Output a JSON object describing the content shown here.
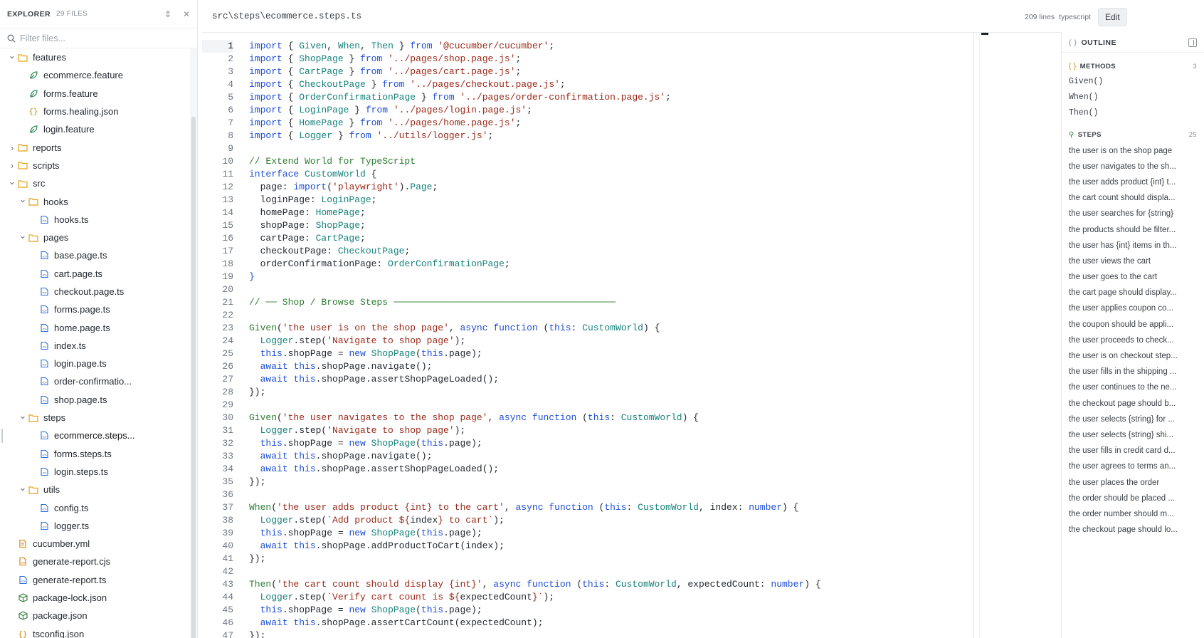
{
  "explorer": {
    "title": "EXPLORER",
    "count": "29 FILES",
    "filter_placeholder": "Filter files...",
    "tree": [
      {
        "label": "features",
        "kind": "folder",
        "depth": 0,
        "open": true
      },
      {
        "label": "ecommerce.feature",
        "kind": "feature",
        "depth": 1
      },
      {
        "label": "forms.feature",
        "kind": "feature",
        "depth": 1
      },
      {
        "label": "forms.healing.json",
        "kind": "json",
        "depth": 1
      },
      {
        "label": "login.feature",
        "kind": "feature",
        "depth": 1
      },
      {
        "label": "reports",
        "kind": "folder",
        "depth": 0,
        "open": false
      },
      {
        "label": "scripts",
        "kind": "folder",
        "depth": 0,
        "open": false
      },
      {
        "label": "src",
        "kind": "folder",
        "depth": 0,
        "open": true
      },
      {
        "label": "hooks",
        "kind": "folder",
        "depth": 1,
        "open": true
      },
      {
        "label": "hooks.ts",
        "kind": "ts",
        "depth": 2
      },
      {
        "label": "pages",
        "kind": "folder",
        "depth": 1,
        "open": true
      },
      {
        "label": "base.page.ts",
        "kind": "ts",
        "depth": 2
      },
      {
        "label": "cart.page.ts",
        "kind": "ts",
        "depth": 2
      },
      {
        "label": "checkout.page.ts",
        "kind": "ts",
        "depth": 2
      },
      {
        "label": "forms.page.ts",
        "kind": "ts",
        "depth": 2
      },
      {
        "label": "home.page.ts",
        "kind": "ts",
        "depth": 2
      },
      {
        "label": "index.ts",
        "kind": "ts",
        "depth": 2
      },
      {
        "label": "login.page.ts",
        "kind": "ts",
        "depth": 2
      },
      {
        "label": "order-confirmatio...",
        "kind": "ts",
        "depth": 2
      },
      {
        "label": "shop.page.ts",
        "kind": "ts",
        "depth": 2
      },
      {
        "label": "steps",
        "kind": "folder",
        "depth": 1,
        "open": true
      },
      {
        "label": "ecommerce.steps...",
        "kind": "ts",
        "depth": 2,
        "active": true
      },
      {
        "label": "forms.steps.ts",
        "kind": "ts",
        "depth": 2
      },
      {
        "label": "login.steps.ts",
        "kind": "ts",
        "depth": 2
      },
      {
        "label": "utils",
        "kind": "folder",
        "depth": 1,
        "open": true
      },
      {
        "label": "config.ts",
        "kind": "ts",
        "depth": 2
      },
      {
        "label": "logger.ts",
        "kind": "ts",
        "depth": 2
      },
      {
        "label": "cucumber.yml",
        "kind": "yml",
        "depth": 0
      },
      {
        "label": "generate-report.cjs",
        "kind": "js",
        "depth": 0
      },
      {
        "label": "generate-report.ts",
        "kind": "ts",
        "depth": 0
      },
      {
        "label": "package-lock.json",
        "kind": "pkg",
        "depth": 0
      },
      {
        "label": "package.json",
        "kind": "pkg",
        "depth": 0
      },
      {
        "label": "tsconfig.json",
        "kind": "json",
        "depth": 0
      }
    ]
  },
  "editor": {
    "path": "src\\steps\\ecommerce.steps.ts",
    "lines_count": "209 lines",
    "language": "typescript",
    "edit_label": "Edit",
    "current_line": 1,
    "code": [
      [
        [
          "kw",
          "import"
        ],
        [
          "",
          "{ "
        ],
        [
          "ty",
          "Given"
        ],
        [
          "",
          ", "
        ],
        [
          "ty",
          "When"
        ],
        [
          "",
          ", "
        ],
        [
          "ty",
          "Then"
        ],
        [
          "",
          " } "
        ],
        [
          "kw",
          "from"
        ],
        [
          "",
          " "
        ],
        [
          "st",
          "'@cucumber/cucumber'"
        ],
        [
          "",
          ";"
        ]
      ],
      [
        [
          "kw",
          "import"
        ],
        [
          "",
          "{ "
        ],
        [
          "ty",
          "ShopPage"
        ],
        [
          "",
          " } "
        ],
        [
          "kw",
          "from"
        ],
        [
          "",
          " "
        ],
        [
          "st",
          "'../pages/shop.page.js'"
        ],
        [
          "",
          ";"
        ]
      ],
      [
        [
          "kw",
          "import"
        ],
        [
          "",
          "{ "
        ],
        [
          "ty",
          "CartPage"
        ],
        [
          "",
          " } "
        ],
        [
          "kw",
          "from"
        ],
        [
          "",
          " "
        ],
        [
          "st",
          "'../pages/cart.page.js'"
        ],
        [
          "",
          ";"
        ]
      ],
      [
        [
          "kw",
          "import"
        ],
        [
          "",
          "{ "
        ],
        [
          "ty",
          "CheckoutPage"
        ],
        [
          "",
          " } "
        ],
        [
          "kw",
          "from"
        ],
        [
          "",
          " "
        ],
        [
          "st",
          "'../pages/checkout.page.js'"
        ],
        [
          "",
          ";"
        ]
      ],
      [
        [
          "kw",
          "import"
        ],
        [
          "",
          "{ "
        ],
        [
          "ty",
          "OrderConfirmationPage"
        ],
        [
          "",
          " } "
        ],
        [
          "kw",
          "from"
        ],
        [
          "",
          " "
        ],
        [
          "st",
          "'../pages/order-confirmation.page.js'"
        ],
        [
          "",
          ";"
        ]
      ],
      [
        [
          "kw",
          "import"
        ],
        [
          "",
          "{ "
        ],
        [
          "ty",
          "LoginPage"
        ],
        [
          "",
          " } "
        ],
        [
          "kw",
          "from"
        ],
        [
          "",
          " "
        ],
        [
          "st",
          "'../pages/login.page.js'"
        ],
        [
          "",
          ";"
        ]
      ],
      [
        [
          "kw",
          "import"
        ],
        [
          "",
          "{ "
        ],
        [
          "ty",
          "HomePage"
        ],
        [
          "",
          " } "
        ],
        [
          "kw",
          "from"
        ],
        [
          "",
          " "
        ],
        [
          "st",
          "'../pages/home.page.js'"
        ],
        [
          "",
          ";"
        ]
      ],
      [
        [
          "kw",
          "import"
        ],
        [
          "",
          "{ "
        ],
        [
          "ty",
          "Logger"
        ],
        [
          "",
          " } "
        ],
        [
          "kw",
          "from"
        ],
        [
          "",
          " "
        ],
        [
          "st",
          "'../utils/logger.js'"
        ],
        [
          "",
          ";"
        ]
      ],
      [],
      [
        [
          "cm",
          "// Extend World for TypeScript"
        ]
      ],
      [
        [
          "kw",
          "interface"
        ],
        [
          "",
          " "
        ],
        [
          "ty",
          "CustomWorld"
        ],
        [
          "",
          " {"
        ]
      ],
      [
        [
          "",
          "  page: "
        ],
        [
          "kw",
          "import"
        ],
        [
          "",
          "("
        ],
        [
          "st",
          "'playwright'"
        ],
        [
          "",
          ")."
        ],
        [
          "ty",
          "Page"
        ],
        [
          "",
          ";"
        ]
      ],
      [
        [
          "",
          "  loginPage: "
        ],
        [
          "ty",
          "LoginPage"
        ],
        [
          "",
          ";"
        ]
      ],
      [
        [
          "",
          "  homePage: "
        ],
        [
          "ty",
          "HomePage"
        ],
        [
          "",
          ";"
        ]
      ],
      [
        [
          "",
          "  shopPage: "
        ],
        [
          "ty",
          "ShopPage"
        ],
        [
          "",
          ";"
        ]
      ],
      [
        [
          "",
          "  cartPage: "
        ],
        [
          "ty",
          "CartPage"
        ],
        [
          "",
          ";"
        ]
      ],
      [
        [
          "",
          "  checkoutPage: "
        ],
        [
          "ty",
          "CheckoutPage"
        ],
        [
          "",
          ";"
        ]
      ],
      [
        [
          "",
          "  orderConfirmationPage: "
        ],
        [
          "ty",
          "OrderConfirmationPage"
        ],
        [
          "",
          ";"
        ]
      ],
      [
        [
          "kw",
          "}"
        ]
      ],
      [],
      [
        [
          "cm",
          "// ── Shop / Browse Steps ────────────────────────────────────────"
        ]
      ],
      [],
      [
        [
          "fn",
          "Given"
        ],
        [
          "",
          "("
        ],
        [
          "st",
          "'the user is on the shop page'"
        ],
        [
          "",
          ", "
        ],
        [
          "kw",
          "async function"
        ],
        [
          "",
          " ("
        ],
        [
          "kw",
          "this"
        ],
        [
          "",
          ": "
        ],
        [
          "ty",
          "CustomWorld"
        ],
        [
          "",
          ") {"
        ]
      ],
      [
        [
          "",
          "  "
        ],
        [
          "ty",
          "Logger"
        ],
        [
          "",
          ".step("
        ],
        [
          "st",
          "'Navigate to shop page'"
        ],
        [
          "",
          ");"
        ]
      ],
      [
        [
          "",
          "  "
        ],
        [
          "kw",
          "this"
        ],
        [
          "",
          ".shopPage = "
        ],
        [
          "kw",
          "new"
        ],
        [
          "",
          " "
        ],
        [
          "ty",
          "ShopPage"
        ],
        [
          "",
          "("
        ],
        [
          "kw",
          "this"
        ],
        [
          "",
          ".page);"
        ]
      ],
      [
        [
          "",
          "  "
        ],
        [
          "kw",
          "await"
        ],
        [
          "",
          " "
        ],
        [
          "kw",
          "this"
        ],
        [
          "",
          ".shopPage.navigate();"
        ]
      ],
      [
        [
          "",
          "  "
        ],
        [
          "kw",
          "await"
        ],
        [
          "",
          " "
        ],
        [
          "kw",
          "this"
        ],
        [
          "",
          ".shopPage.assertShopPageLoaded();"
        ]
      ],
      [
        [
          "",
          "});"
        ]
      ],
      [],
      [
        [
          "fn",
          "Given"
        ],
        [
          "",
          "("
        ],
        [
          "st",
          "'the user navigates to the shop page'"
        ],
        [
          "",
          ", "
        ],
        [
          "kw",
          "async function"
        ],
        [
          "",
          " ("
        ],
        [
          "kw",
          "this"
        ],
        [
          "",
          ": "
        ],
        [
          "ty",
          "CustomWorld"
        ],
        [
          "",
          ") {"
        ]
      ],
      [
        [
          "",
          "  "
        ],
        [
          "ty",
          "Logger"
        ],
        [
          "",
          ".step("
        ],
        [
          "st",
          "'Navigate to shop page'"
        ],
        [
          "",
          ");"
        ]
      ],
      [
        [
          "",
          "  "
        ],
        [
          "kw",
          "this"
        ],
        [
          "",
          ".shopPage = "
        ],
        [
          "kw",
          "new"
        ],
        [
          "",
          " "
        ],
        [
          "ty",
          "ShopPage"
        ],
        [
          "",
          "("
        ],
        [
          "kw",
          "this"
        ],
        [
          "",
          ".page);"
        ]
      ],
      [
        [
          "",
          "  "
        ],
        [
          "kw",
          "await"
        ],
        [
          "",
          " "
        ],
        [
          "kw",
          "this"
        ],
        [
          "",
          ".shopPage.navigate();"
        ]
      ],
      [
        [
          "",
          "  "
        ],
        [
          "kw",
          "await"
        ],
        [
          "",
          " "
        ],
        [
          "kw",
          "this"
        ],
        [
          "",
          ".shopPage.assertShopPageLoaded();"
        ]
      ],
      [
        [
          "",
          "});"
        ]
      ],
      [],
      [
        [
          "fn",
          "When"
        ],
        [
          "",
          "("
        ],
        [
          "st",
          "'the user adds product {int} to the cart'"
        ],
        [
          "",
          ", "
        ],
        [
          "kw",
          "async function"
        ],
        [
          "",
          " ("
        ],
        [
          "kw",
          "this"
        ],
        [
          "",
          ": "
        ],
        [
          "ty",
          "CustomWorld"
        ],
        [
          "",
          ", index: "
        ],
        [
          "kw",
          "number"
        ],
        [
          "",
          ") {"
        ]
      ],
      [
        [
          "",
          "  "
        ],
        [
          "ty",
          "Logger"
        ],
        [
          "",
          ".step("
        ],
        [
          "st",
          "`Add product ${"
        ],
        [
          "",
          "index"
        ],
        [
          "st",
          "} to cart`"
        ],
        [
          "",
          ");"
        ]
      ],
      [
        [
          "",
          "  "
        ],
        [
          "kw",
          "this"
        ],
        [
          "",
          ".shopPage = "
        ],
        [
          "kw",
          "new"
        ],
        [
          "",
          " "
        ],
        [
          "ty",
          "ShopPage"
        ],
        [
          "",
          "("
        ],
        [
          "kw",
          "this"
        ],
        [
          "",
          ".page);"
        ]
      ],
      [
        [
          "",
          "  "
        ],
        [
          "kw",
          "await"
        ],
        [
          "",
          " "
        ],
        [
          "kw",
          "this"
        ],
        [
          "",
          ".shopPage.addProductToCart(index);"
        ]
      ],
      [
        [
          "",
          "});"
        ]
      ],
      [],
      [
        [
          "fn",
          "Then"
        ],
        [
          "",
          "("
        ],
        [
          "st",
          "'the cart count should display {int}'"
        ],
        [
          "",
          ", "
        ],
        [
          "kw",
          "async function"
        ],
        [
          "",
          " ("
        ],
        [
          "kw",
          "this"
        ],
        [
          "",
          ": "
        ],
        [
          "ty",
          "CustomWorld"
        ],
        [
          "",
          ", expectedCount: "
        ],
        [
          "kw",
          "number"
        ],
        [
          "",
          ") {"
        ]
      ],
      [
        [
          "",
          "  "
        ],
        [
          "ty",
          "Logger"
        ],
        [
          "",
          ".step("
        ],
        [
          "st",
          "`Verify cart count is ${"
        ],
        [
          "",
          "expectedCount"
        ],
        [
          "st",
          "}`"
        ],
        [
          "",
          ");"
        ]
      ],
      [
        [
          "",
          "  "
        ],
        [
          "kw",
          "this"
        ],
        [
          "",
          ".shopPage = "
        ],
        [
          "kw",
          "new"
        ],
        [
          "",
          " "
        ],
        [
          "ty",
          "ShopPage"
        ],
        [
          "",
          "("
        ],
        [
          "kw",
          "this"
        ],
        [
          "",
          ".page);"
        ]
      ],
      [
        [
          "",
          "  "
        ],
        [
          "kw",
          "await"
        ],
        [
          "",
          " "
        ],
        [
          "kw",
          "this"
        ],
        [
          "",
          ".shopPage.assertCartCount(expectedCount);"
        ]
      ],
      [
        [
          "",
          "});"
        ]
      ]
    ]
  },
  "outline": {
    "title": "OUTLINE",
    "methods_label": "METHODS",
    "methods_count": "3",
    "methods": [
      "Given()",
      "When()",
      "Then()"
    ],
    "steps_label": "STEPS",
    "steps_count": "25",
    "steps": [
      "the user is on the shop page",
      "the user navigates to the sh...",
      "the user adds product {int} t...",
      "the cart count should displa...",
      "the user searches for {string}",
      "the products should be filter...",
      "the user has {int} items in th...",
      "the user views the cart",
      "the user goes to the cart",
      "the cart page should display...",
      "the user applies coupon co...",
      "the coupon should be appli...",
      "the user proceeds to check...",
      "the user is on checkout step...",
      "the user fills in the shipping ...",
      "the user continues to the ne...",
      "the checkout page should b...",
      "the user selects {string} for ...",
      "the user selects {string} shi...",
      "the user fills in credit card d...",
      "the user agrees to terms an...",
      "the user places the order",
      "the order should be placed ...",
      "the order number should m...",
      "the checkout page should lo..."
    ]
  },
  "colors": {
    "keyword": "#1d4ed8",
    "type": "#16827a",
    "string": "#9a2a1a",
    "comment": "#2e7d32",
    "folder": "#e3a21a",
    "feature": "#2e8b57",
    "ts": "#2f6fd6"
  }
}
